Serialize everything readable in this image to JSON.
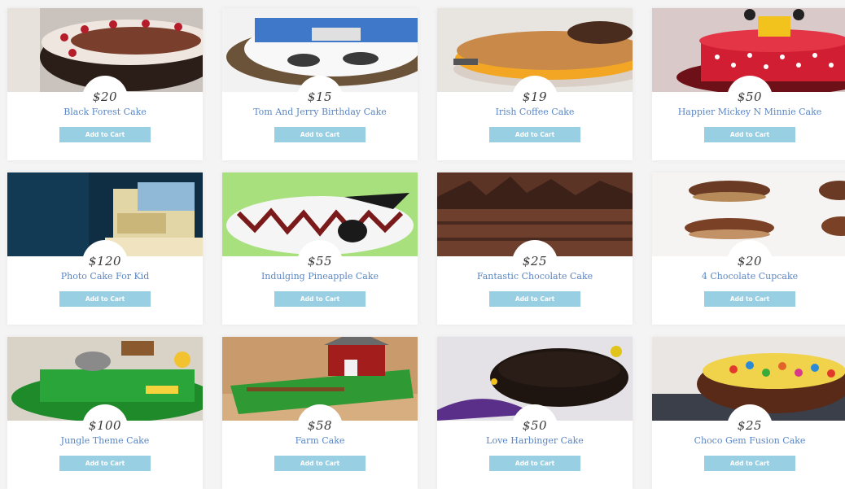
{
  "products": [
    {
      "name": "Black Forest Cake",
      "price": "$20",
      "button": "Add to Cart",
      "image": "black-forest-cake-image"
    },
    {
      "name": "Tom And Jerry Birthday Cake",
      "price": "$15",
      "button": "Add to Cart",
      "image": "tom-and-jerry-cake-image"
    },
    {
      "name": "Irish Coffee Cake",
      "price": "$19",
      "button": "Add to Cart",
      "image": "irish-coffee-cake-image"
    },
    {
      "name": "Happier Mickey N Minnie Cake",
      "price": "$50",
      "button": "Add to Cart",
      "image": "mickey-minnie-cake-image"
    },
    {
      "name": "Photo Cake For Kid",
      "price": "$120",
      "button": "Add to Cart",
      "image": "photo-cake-image"
    },
    {
      "name": "Indulging Pineapple Cake",
      "price": "$55",
      "button": "Add to Cart",
      "image": "pineapple-cake-image"
    },
    {
      "name": "Fantastic Chocolate Cake",
      "price": "$25",
      "button": "Add to Cart",
      "image": "chocolate-cake-image"
    },
    {
      "name": "4 Chocolate Cupcake",
      "price": "$20",
      "button": "Add to Cart",
      "image": "chocolate-cupcake-image"
    },
    {
      "name": "Jungle Theme Cake",
      "price": "$100",
      "button": "Add to Cart",
      "image": "jungle-theme-cake-image"
    },
    {
      "name": "Farm Cake",
      "price": "$58",
      "button": "Add to Cart",
      "image": "farm-cake-image"
    },
    {
      "name": "Love Harbinger Cake",
      "price": "$50",
      "button": "Add to Cart",
      "image": "love-harbinger-cake-image"
    },
    {
      "name": "Choco Gem Fusion Cake",
      "price": "$25",
      "button": "Add to Cart",
      "image": "choco-gem-cake-image"
    }
  ],
  "colors": {
    "background": "#f4f4f4",
    "card": "#ffffff",
    "product_name": "#5b86c4",
    "button": "#98cfe2",
    "button_text": "#ffffff",
    "price": "#3a3a3a"
  }
}
